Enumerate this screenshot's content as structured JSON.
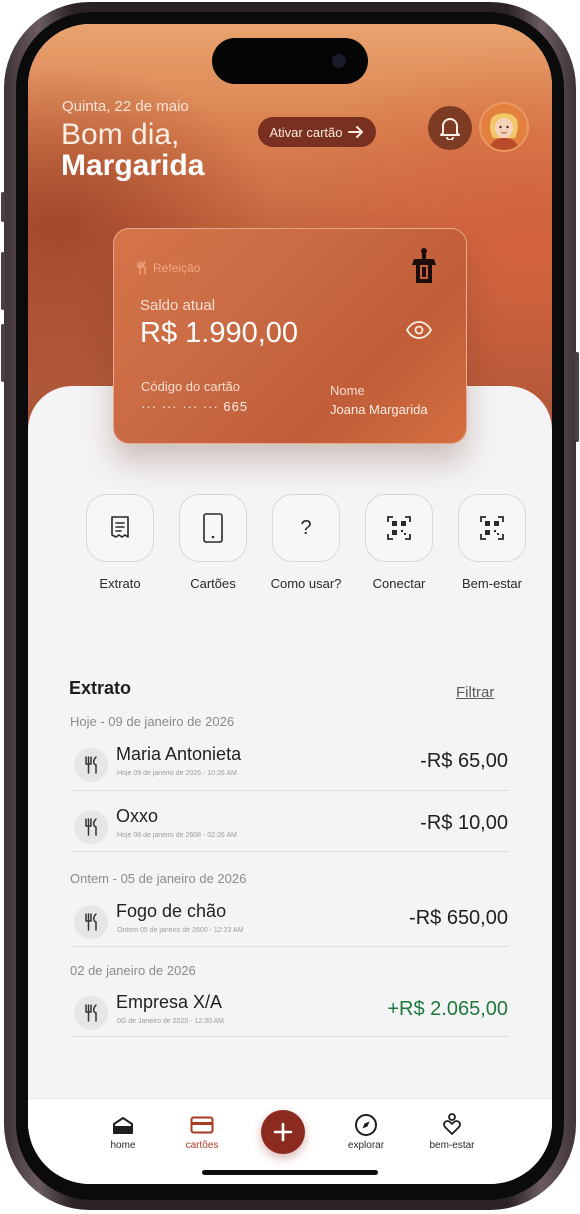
{
  "header": {
    "date": "Quinta, 22 de maio",
    "greeting": "Bom dia,",
    "user_name": "Margarida",
    "activate_label": "Ativar cartão"
  },
  "card": {
    "type_label": "Refeição",
    "balance_label": "Saldo atual",
    "balance": "R$ 1.990,00",
    "code_label": "Código do cartão",
    "code_masked": "··· ··· ··· ··· 665",
    "name_label": "Nome",
    "holder": "Joana Margarida"
  },
  "actions": [
    {
      "label": "Extrato",
      "icon": "receipt-icon"
    },
    {
      "label": "Cartões",
      "icon": "phone-card-icon"
    },
    {
      "label": "Como usar?",
      "icon": "question-icon"
    },
    {
      "label": "Conectar",
      "icon": "qr-code-icon"
    },
    {
      "label": "Bem-estar",
      "icon": "qr-code-icon"
    }
  ],
  "statement": {
    "title": "Extrato",
    "filter_label": "Filtrar",
    "groups": [
      {
        "label": "Hoje - 09 de janeiro de 2026",
        "items": [
          {
            "title": "Maria Antonieta",
            "subtitle": "Hoje 09 de janeiro de 2026 - 10:26 AM",
            "amount": "-R$ 65,00",
            "icon": "cutlery-icon"
          },
          {
            "title": "Oxxo",
            "subtitle": "Hoje 08 de janeiro de 2608 - 02:26 AM",
            "amount": "-R$ 10,00",
            "icon": "cutlery-icon"
          }
        ]
      },
      {
        "label": "Ontem - 05 de janeiro de 2026",
        "items": [
          {
            "title": "Fogo de chão",
            "subtitle": "Ontem 05 de janeiro de 2600 - 12:23 AM",
            "amount": "-R$ 650,00",
            "icon": "cutlery-icon"
          }
        ]
      },
      {
        "label": "02 de janeiro de 2026",
        "items": [
          {
            "title": "Empresa X/A",
            "subtitle": "0G de Janeiro de 2020 - 12:30 AM",
            "amount": "+R$ 2.065,00",
            "icon": "cutlery-icon"
          }
        ]
      }
    ]
  },
  "nav": {
    "items": [
      {
        "label": "home",
        "icon": "home-icon"
      },
      {
        "label": "cartões",
        "icon": "card-icon",
        "active": true
      },
      {
        "label": "add",
        "icon": "plus-icon"
      },
      {
        "label": "explorar",
        "icon": "compass-icon"
      },
      {
        "label": "bem-estar",
        "icon": "heart-person-icon"
      }
    ]
  },
  "colors": {
    "accent": "#8b2a1e",
    "active_nav": "#a93a22",
    "positive": "#1e7a3a",
    "card": "#c86a44"
  }
}
